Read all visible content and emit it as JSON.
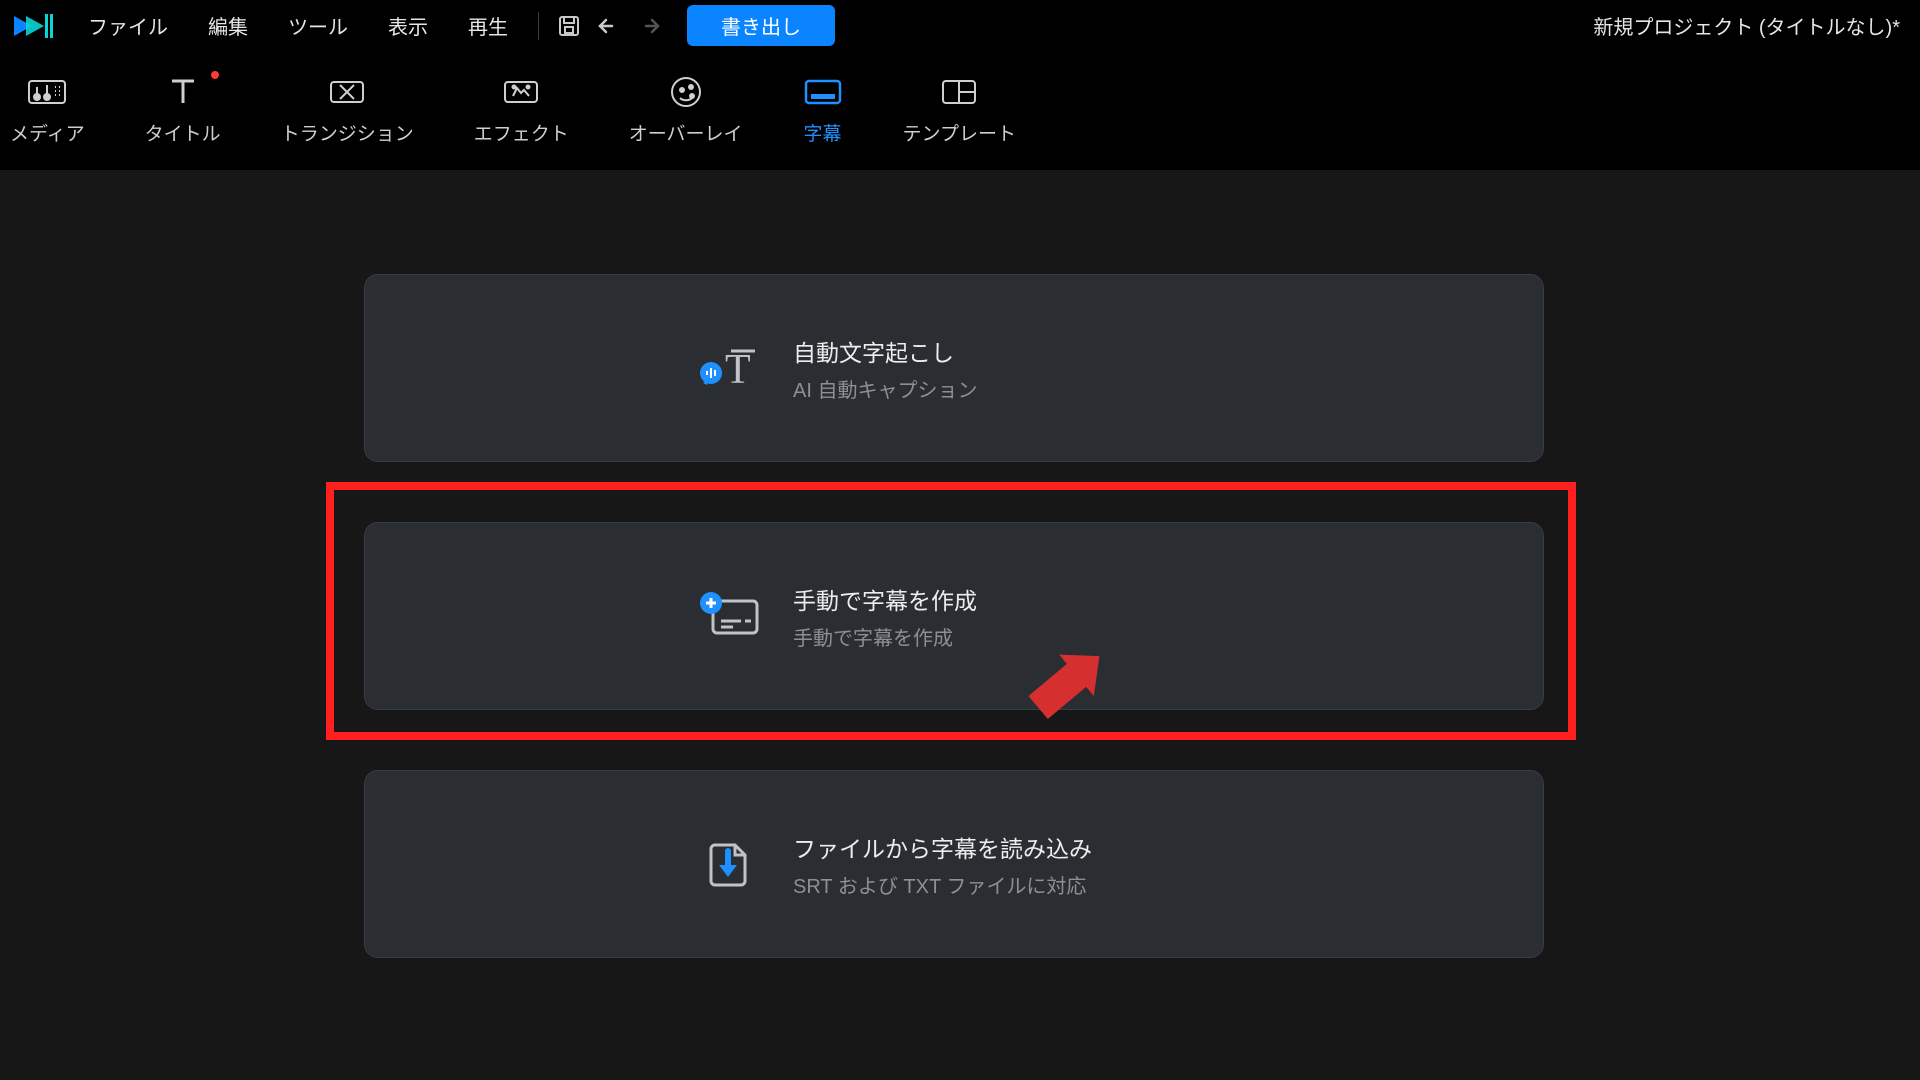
{
  "menubar": {
    "items": [
      "ファイル",
      "編集",
      "ツール",
      "表示",
      "再生"
    ],
    "export_label": "書き出し",
    "project_title": "新規プロジェクト (タイトルなし)*"
  },
  "tooltabs": {
    "items": [
      {
        "label": "メディア",
        "icon": "media"
      },
      {
        "label": "タイトル",
        "icon": "title",
        "badge": true
      },
      {
        "label": "トランジション",
        "icon": "transition"
      },
      {
        "label": "エフェクト",
        "icon": "effect"
      },
      {
        "label": "オーバーレイ",
        "icon": "overlay"
      },
      {
        "label": "字幕",
        "icon": "subtitle",
        "active": true
      },
      {
        "label": "テンプレート",
        "icon": "template"
      }
    ]
  },
  "cards": [
    {
      "title": "自動文字起こし",
      "sub": "AI 自動キャプション",
      "icon": "auto"
    },
    {
      "title": "手動で字幕を作成",
      "sub": "手動で字幕を作成",
      "icon": "manual",
      "highlighted": true
    },
    {
      "title": "ファイルから字幕を読み込み",
      "sub": "SRT および TXT ファイルに対応",
      "icon": "import"
    }
  ],
  "colors": {
    "accent": "#1e90ff",
    "highlight": "#ff1f1f"
  }
}
